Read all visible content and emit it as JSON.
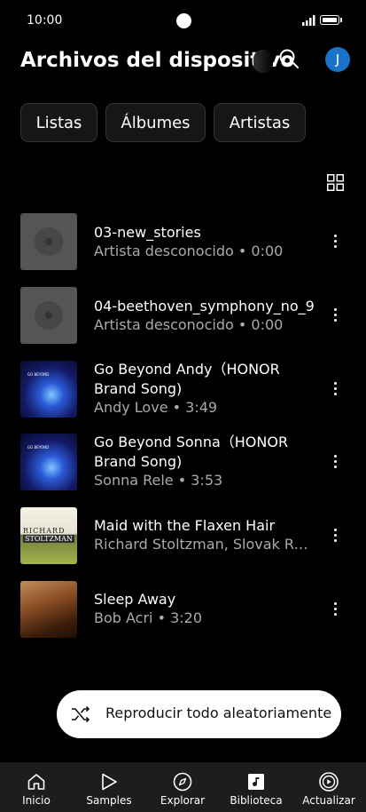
{
  "status_bar": {
    "time": "10:00"
  },
  "header": {
    "title": "Archivos del dispositivo",
    "avatar_initial": "J"
  },
  "chips": [
    {
      "label": "Listas"
    },
    {
      "label": "Álbumes"
    },
    {
      "label": "Artistas"
    }
  ],
  "tracks": [
    {
      "title": "03-new_stories",
      "subtitle": "Artista desconocido • 0:00",
      "art": "placeholder"
    },
    {
      "title": "04-beethoven_symphony_no_9",
      "subtitle": "Artista desconocido • 0:00",
      "art": "placeholder"
    },
    {
      "title": "Go Beyond Andy（HONOR Brand Song)",
      "subtitle": "Andy Love • 3:49",
      "art": "honor",
      "art_text": "GO BEYOND"
    },
    {
      "title": "Go Beyond Sonna（HONOR Brand Song)",
      "subtitle": "Sonna Rele • 3:53",
      "art": "honor",
      "art_text": "GO BEYOND"
    },
    {
      "title": "Maid with the Flaxen Hair",
      "subtitle": "Richard Stoltzman, Slovak Radi…",
      "art": "richard",
      "art_text_1": "RICHARD",
      "art_text_2": "STOLTZMAN"
    },
    {
      "title": "Sleep Away",
      "subtitle": "Bob Acri • 3:20",
      "art": "sleep"
    }
  ],
  "shuffle_button": {
    "label": "Reproducir todo aleatoriamente"
  },
  "bottom_nav": [
    {
      "label": "Inicio",
      "icon": "home-icon"
    },
    {
      "label": "Samples",
      "icon": "samples-icon"
    },
    {
      "label": "Explorar",
      "icon": "compass-icon"
    },
    {
      "label": "Biblioteca",
      "icon": "library-icon"
    },
    {
      "label": "Actualizar",
      "icon": "upgrade-icon"
    }
  ]
}
